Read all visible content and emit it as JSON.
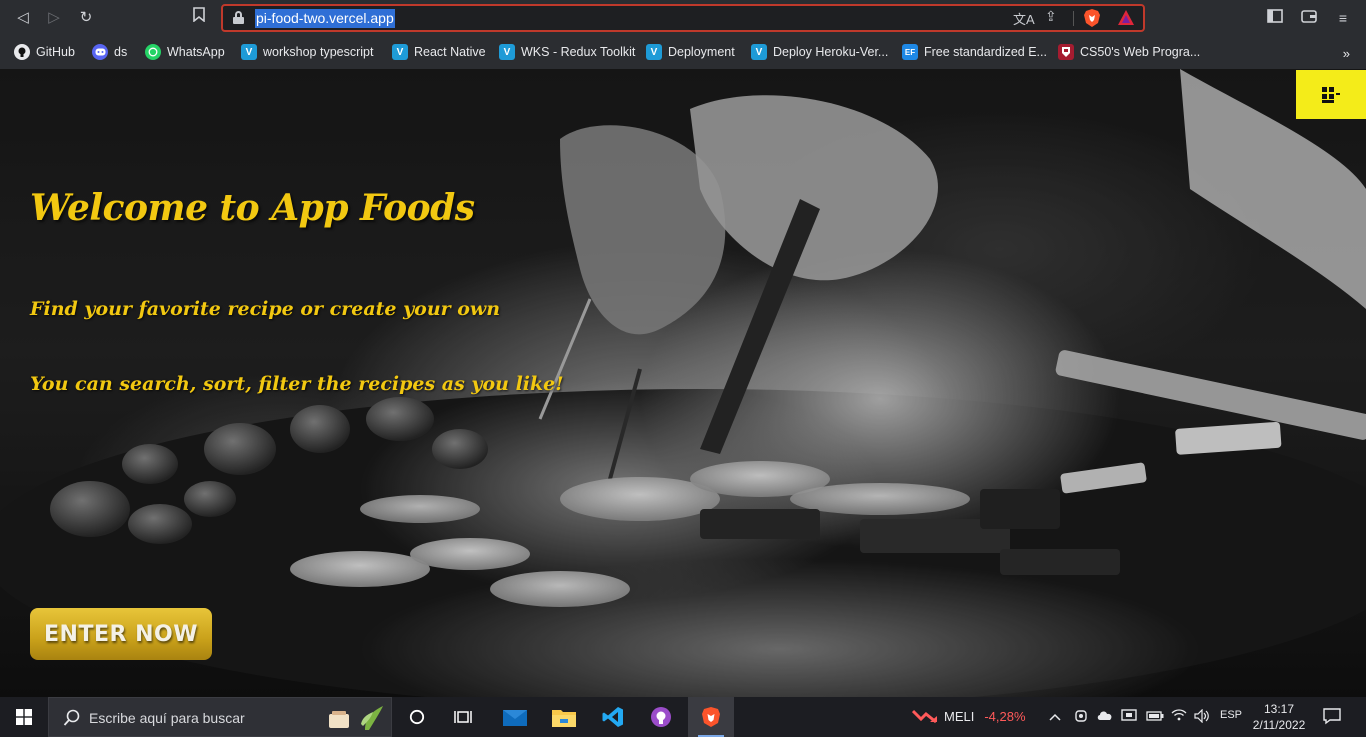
{
  "browser": {
    "url": "pi-food-two.vercel.app",
    "bookmarks": [
      {
        "label": "GitHub",
        "icon": "github-icon",
        "color": "#e8e9ec"
      },
      {
        "label": "ds",
        "icon": "discord-icon",
        "color": "#5865f2"
      },
      {
        "label": "WhatsApp",
        "icon": "whatsapp-icon",
        "color": "#25d366"
      },
      {
        "label": "workshop typescript",
        "icon": "vercel-v-icon",
        "color": "#1e9bd7"
      },
      {
        "label": "React Native",
        "icon": "vercel-v-icon",
        "color": "#1e9bd7"
      },
      {
        "label": "WKS - Redux Toolkit",
        "icon": "vercel-v-icon",
        "color": "#1e9bd7"
      },
      {
        "label": "Deployment",
        "icon": "vercel-v-icon",
        "color": "#1e9bd7"
      },
      {
        "label": "Deploy Heroku-Ver...",
        "icon": "vercel-v-icon",
        "color": "#1e9bd7"
      },
      {
        "label": "Free standardized E...",
        "icon": "ef-icon",
        "color": "#1e88e5"
      },
      {
        "label": "CS50's Web Progra...",
        "icon": "harvard-icon",
        "color": "#a51c30"
      }
    ],
    "bookmark_icon_text": {
      "v": "V",
      "ef": "EF"
    }
  },
  "hero": {
    "title": "Welcome to App Foods",
    "subtitle_1": "Find your favorite recipe or create your own",
    "subtitle_2": "You can search, sort, filter the recipes as you like!",
    "cta": "ENTER NOW",
    "accent_color": "#f2c811"
  },
  "taskbar": {
    "search_placeholder": "Escribe aquí para buscar",
    "ticker_symbol": "MELI",
    "ticker_change": "-4,28%",
    "language": "ESP",
    "time": "13:17",
    "date": "2/11/2022"
  }
}
